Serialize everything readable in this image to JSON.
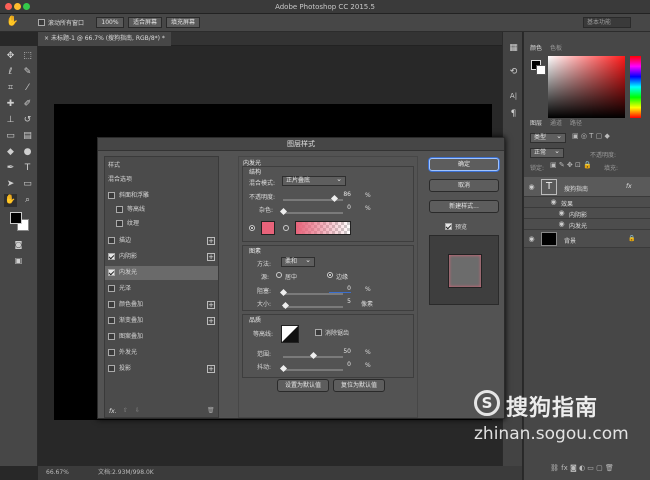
{
  "app": {
    "title": "Adobe Photoshop CC 2015.5"
  },
  "options": {
    "scroll_all": "滚动所有窗口",
    "zoom": "100%",
    "fit_screen": "适合屏幕",
    "fill_screen": "填充屏幕",
    "workspace": "基本功能"
  },
  "document": {
    "tab": "未标题-1 @ 66.7% (搜狗指南, RGB/8*) *"
  },
  "status": {
    "zoom": "66.67%",
    "doc": "文档:2.93M/998.0K"
  },
  "panels": {
    "color_tab": "颜色",
    "swatches_tab": "色板",
    "layers_tab": "图层",
    "channels_tab": "通道",
    "paths_tab": "路径",
    "kind": "类型",
    "blend": "正常",
    "opacity_label": "不透明度:",
    "lock_label": "锁定:",
    "fill_label": "填充:"
  },
  "layers": [
    {
      "name": "搜狗指南",
      "fx": "fx"
    },
    {
      "name": "效果"
    },
    {
      "name": "内阴影"
    },
    {
      "name": "内发光"
    },
    {
      "name": "背景"
    }
  ],
  "dialog": {
    "title": "图层样式",
    "styles_label": "样式",
    "blend_options": "混合选项",
    "styles": [
      {
        "label": "斜面和浮雕",
        "checked": false
      },
      {
        "label": "等高线",
        "checked": false
      },
      {
        "label": "纹理",
        "checked": false
      },
      {
        "label": "描边",
        "checked": false
      },
      {
        "label": "内阴影",
        "checked": true
      },
      {
        "label": "内发光",
        "checked": true
      },
      {
        "label": "光泽",
        "checked": false
      },
      {
        "label": "颜色叠加",
        "checked": false
      },
      {
        "label": "渐变叠加",
        "checked": false
      },
      {
        "label": "图案叠加",
        "checked": false
      },
      {
        "label": "外发光",
        "checked": false
      },
      {
        "label": "投影",
        "checked": false
      }
    ],
    "fx_label": "fx.",
    "section_title": "内发光",
    "structure": {
      "title": "结构",
      "blend_mode_label": "混合模式:",
      "blend_mode": "正片叠底",
      "opacity_label": "不透明度:",
      "opacity": "86",
      "noise_label": "杂色:",
      "noise": "0",
      "percent": "%"
    },
    "elements": {
      "title": "图素",
      "method_label": "方法:",
      "method": "柔和",
      "source_label": "源:",
      "center": "居中",
      "edge": "边缘",
      "choke_label": "阻塞:",
      "choke": "0",
      "size_label": "大小:",
      "size": "5",
      "px": "像素"
    },
    "quality": {
      "title": "品质",
      "contour_label": "等高线:",
      "antialias": "消除锯齿",
      "range_label": "范围:",
      "range": "50",
      "jitter_label": "抖动:",
      "jitter": "0"
    },
    "make_default": "设置为默认值",
    "reset_default": "复位为默认值",
    "ok": "确定",
    "cancel": "取消",
    "new_style": "新建样式...",
    "preview": "预览"
  },
  "watermark": {
    "brand": "搜狗指南",
    "url": "zhinan.sogou.com"
  },
  "colors": {
    "accent": "#3b6fcf",
    "glow": "#e8637a"
  }
}
